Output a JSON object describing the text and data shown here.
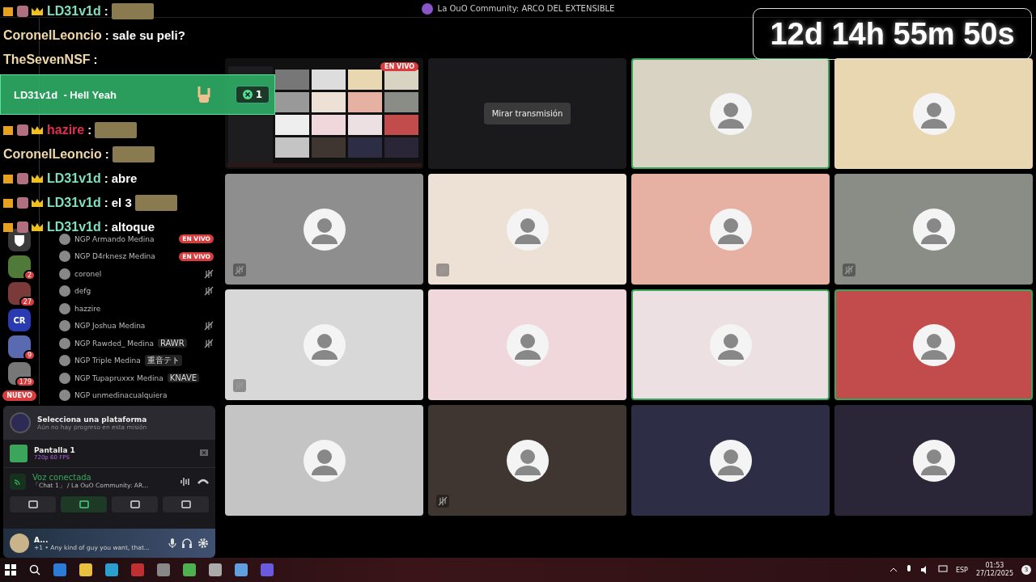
{
  "window": {
    "title": "La OuO Community: ARCO DEL EXTENSIBLE"
  },
  "timer": "12d 14h 55m 50s",
  "chat_overlay": [
    {
      "user": "LD31v1d",
      "colon": ":",
      "emote": true,
      "badges": true,
      "color": "#7fe0c0"
    },
    {
      "user": "CoronelLeoncio",
      "colon": ":",
      "text": "sale su peli?",
      "emote": false,
      "badges": false,
      "color": "#f0d8a8"
    },
    {
      "user": "TheSevenNSF",
      "colon": ":",
      "emote": false,
      "badges": false,
      "color": "#f0d8a8"
    },
    {
      "user": "hazire",
      "colon": ":",
      "emote": true,
      "badges": true,
      "color": "#e03050"
    },
    {
      "user": "CoronelLeoncio",
      "colon": ":",
      "emote": true,
      "badges": false,
      "color": "#f0d8a8"
    },
    {
      "user": "LD31v1d",
      "colon": ":",
      "text": "abre",
      "emote": false,
      "badges": true,
      "color": "#7fe0c0"
    },
    {
      "user": "LD31v1d",
      "colon": ":",
      "text": "el 3",
      "emote": true,
      "badges": true,
      "color": "#7fe0c0"
    },
    {
      "user": "LD31v1d",
      "colon": ":",
      "text": "altoque",
      "emote": false,
      "badges": true,
      "color": "#7fe0c0"
    }
  ],
  "alert": {
    "text": "LD31v1d  - Hell Yeah",
    "count": "1"
  },
  "servers": [
    {
      "badge": "2"
    },
    {
      "badge": "27"
    },
    {
      "label": "CR"
    },
    {
      "badge": "9"
    },
    {
      "badge": "179"
    }
  ],
  "new_pill": "NUEVO",
  "members": [
    {
      "name": "NGP Armando Medina",
      "tag": "EN VIVO",
      "muted": false
    },
    {
      "name": "NGP D4rknesz Medina",
      "tag": "EN VIVO",
      "muted": false
    },
    {
      "name": "coronel",
      "muted": true
    },
    {
      "name": "defg",
      "muted": true
    },
    {
      "name": "hazzire",
      "muted": false
    },
    {
      "name": "NGP Joshua Medina",
      "muted": true
    },
    {
      "name": "NGP Rawded_ Medina",
      "status": "RAWR",
      "muted": true
    },
    {
      "name": "NGP Triple Medina",
      "status": "重音テト",
      "muted": false
    },
    {
      "name": "NGP Tupapruxxx Medina",
      "status": "KNAVE",
      "muted": false
    },
    {
      "name": "NGP unmedinacualquiera",
      "muted": false
    }
  ],
  "quest": {
    "title": "Selecciona una plataforma",
    "subtitle": "Aún no hay progreso en esta misión"
  },
  "stream": {
    "title": "Pantalla 1",
    "quality": "720p 60 FPS"
  },
  "voice": {
    "status": "Voz conectada",
    "channel": "「Chat 1」 / La OuO Community: AR..."
  },
  "voice_buttons": [
    {
      "selected": false
    },
    {
      "selected": true
    },
    {
      "selected": false
    },
    {
      "selected": false
    }
  ],
  "user": {
    "name": "A...",
    "status": "+1 • Any kind of guy you want, that..."
  },
  "tiles": [
    {
      "kind": "stream",
      "badge": "EN VIVO",
      "color": "#111111",
      "speaking": false,
      "muted": false
    },
    {
      "kind": "stream",
      "label": "Mirar transmisión",
      "color": "#1a1a1c",
      "speaking": false,
      "muted": false
    },
    {
      "kind": "avatar",
      "color": "#d9d3c3",
      "speaking": true,
      "muted": false
    },
    {
      "kind": "avatar",
      "color": "#e8d7b0",
      "speaking": false,
      "muted": false
    },
    {
      "kind": "avatar",
      "color": "#8e8e8e",
      "speaking": false,
      "muted": true
    },
    {
      "kind": "avatar",
      "color": "#ede0d5",
      "speaking": false,
      "muted": true
    },
    {
      "kind": "avatar",
      "color": "#e6b1a2",
      "speaking": false,
      "muted": false
    },
    {
      "kind": "avatar",
      "color": "#8a8d85",
      "speaking": false,
      "muted": true
    },
    {
      "kind": "avatar",
      "color": "#d8d8d8",
      "speaking": false,
      "muted": true
    },
    {
      "kind": "avatar",
      "color": "#f0d7dc",
      "speaking": false,
      "muted": false
    },
    {
      "kind": "avatar",
      "color": "#ede0e2",
      "speaking": true,
      "muted": false
    },
    {
      "kind": "avatar",
      "color": "#c24b4b",
      "speaking": true,
      "muted": false
    },
    {
      "kind": "avatar",
      "color": "#c4c4c4",
      "speaking": false,
      "muted": false
    },
    {
      "kind": "avatar",
      "color": "#3f3632",
      "speaking": false,
      "muted": true
    },
    {
      "kind": "avatar",
      "color": "#2d2d45",
      "speaking": false,
      "muted": false
    },
    {
      "kind": "avatar",
      "color": "#2a2638",
      "speaking": false,
      "muted": false
    }
  ],
  "taskbar": {
    "language": "ESP",
    "time": "01:53",
    "date": "27/12/2025",
    "notifications": "3"
  }
}
